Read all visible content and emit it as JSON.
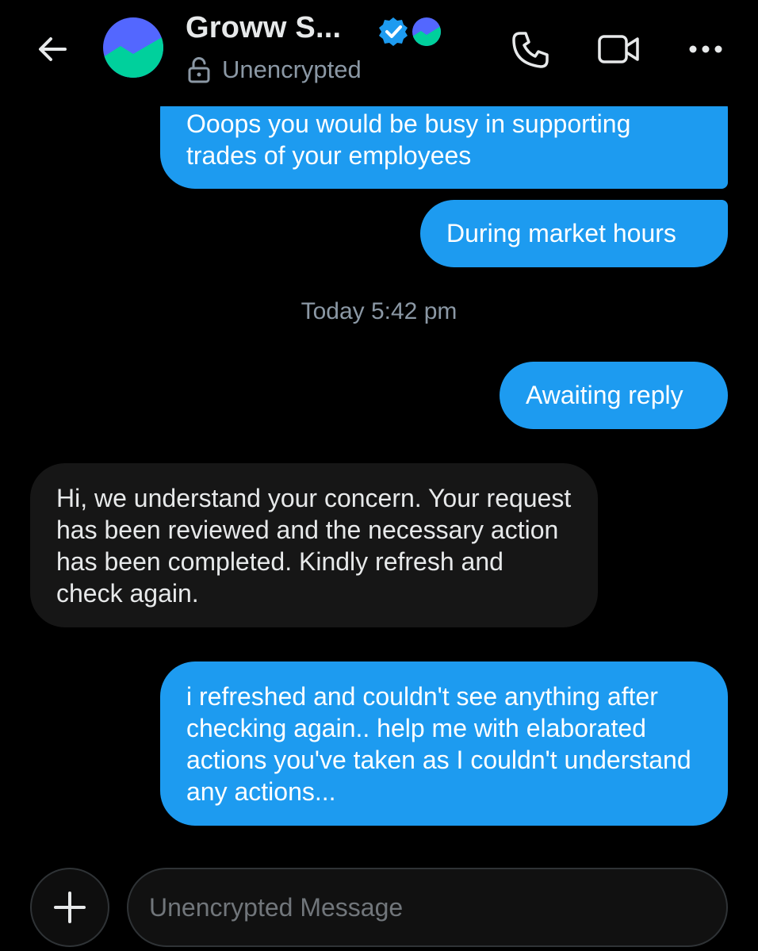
{
  "header": {
    "title": "Groww S...",
    "status": "Unencrypted"
  },
  "messages": [
    {
      "direction": "sent",
      "text": "Ooops you would be busy in supporting trades of your employees"
    },
    {
      "direction": "sent",
      "text": "During market hours"
    },
    {
      "direction": "sent",
      "text": "Awaiting reply"
    },
    {
      "direction": "received",
      "text": "Hi, we understand your concern. Your request has been reviewed and the necessary action has been completed. Kindly refresh and check again."
    },
    {
      "direction": "sent",
      "text": "i refreshed and couldn't see anything after checking again.. help me with elaborated actions you've taken as I couldn't understand any actions..."
    }
  ],
  "timestamp": "Today 5:42 pm",
  "composer": {
    "placeholder": "Unencrypted Message"
  },
  "colors": {
    "background": "#000000",
    "sent_bubble": "#1d9bf0",
    "received_bubble": "#161616",
    "secondary_text": "#8b98a5",
    "verified_badge": "#1d9bf0"
  },
  "icons": [
    "back-arrow-icon",
    "avatar",
    "verified-badge-icon",
    "affiliate-badge-icon",
    "lock-open-icon",
    "phone-icon",
    "video-icon",
    "more-icon",
    "plus-icon"
  ]
}
